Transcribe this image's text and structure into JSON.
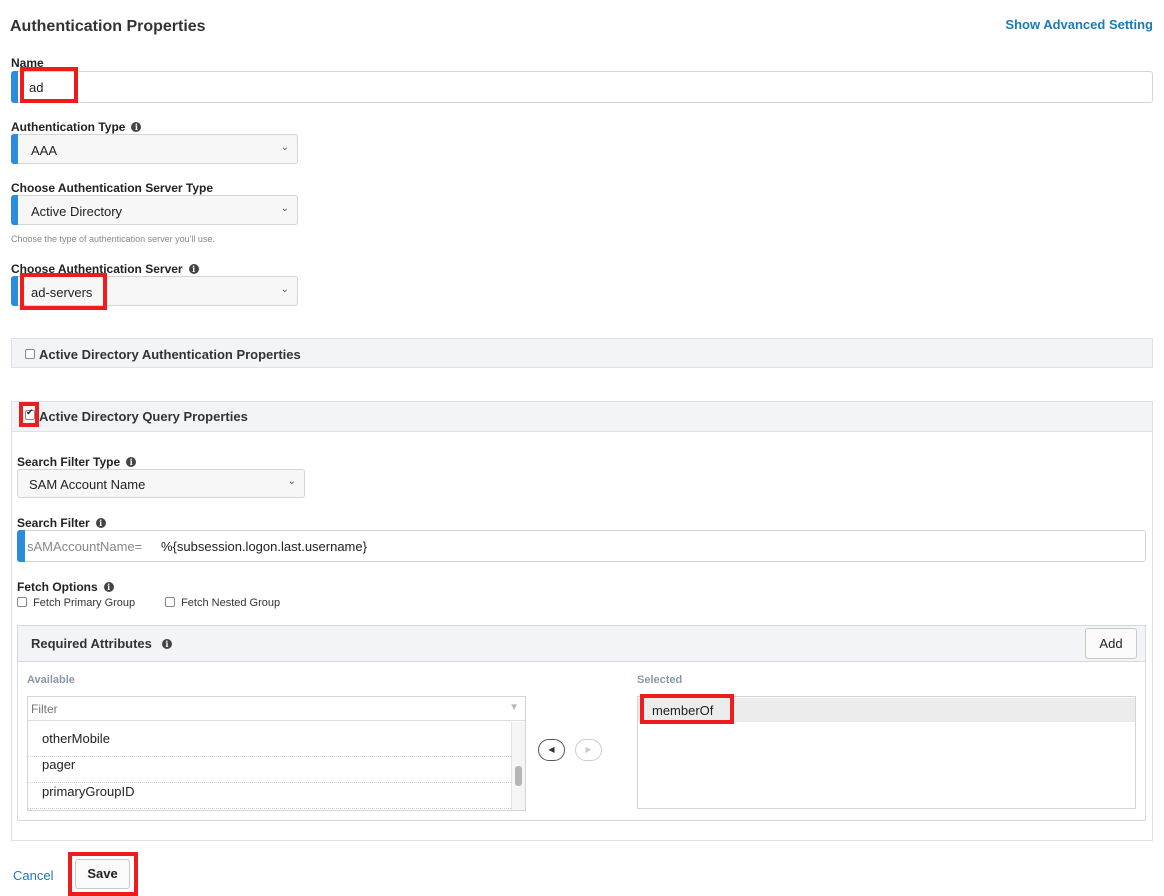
{
  "header": {
    "title": "Authentication Properties",
    "advanced_link": "Show Advanced Setting"
  },
  "form": {
    "name_label": "Name",
    "name_value": "ad",
    "auth_type_label": "Authentication Type",
    "auth_type_value": "AAA",
    "server_type_label": "Choose Authentication Server Type",
    "server_type_value": "Active Directory",
    "server_type_hint": "Choose the type of authentication server you'll use.",
    "server_label": "Choose Authentication Server",
    "server_value": "ad-servers"
  },
  "ad_auth_panel": {
    "title": "Active Directory Authentication Properties",
    "checked": false
  },
  "ad_query_panel": {
    "title": "Active Directory Query Properties",
    "checked": true,
    "search_filter_type_label": "Search Filter Type",
    "search_filter_type_value": "SAM Account Name",
    "search_filter_label": "Search Filter",
    "search_filter_prefix": "sAMAccountName=",
    "search_filter_value": "%{subsession.logon.last.username}",
    "fetch_options_label": "Fetch Options",
    "fetch_primary_group": "Fetch Primary Group",
    "fetch_nested_group": "Fetch Nested Group",
    "required_attributes": {
      "title": "Required Attributes",
      "add_button": "Add",
      "available_label": "Available",
      "filter_placeholder": "Filter",
      "available_items": [
        "otherMobile",
        "pager",
        "primaryGroupID"
      ],
      "selected_label": "Selected",
      "selected_items": [
        "memberOf"
      ]
    }
  },
  "footer": {
    "cancel": "Cancel",
    "save": "Save"
  },
  "colors": {
    "accent_bar": "#2b8cdf",
    "link": "#1a7bb9",
    "highlight": "#ee1c1c"
  }
}
